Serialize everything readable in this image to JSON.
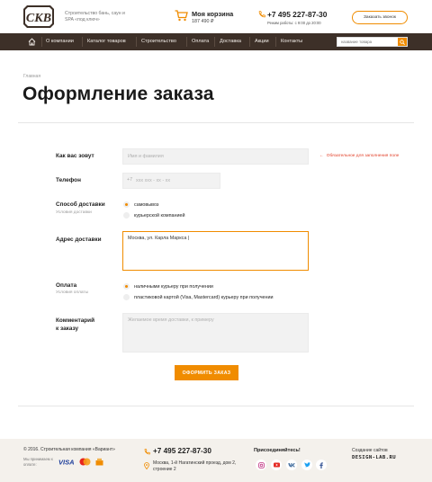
{
  "header": {
    "tagline": "Строительство бань, саун и SPA «под ключ»",
    "cart_title": "Моя корзина",
    "cart_sum": "187 490 ₽",
    "phone": "+7 495 227-87-30",
    "hours": "Режим работы: с 9:00 до 20:00",
    "callback_label": "Заказать звонок"
  },
  "nav": {
    "items": [
      "О компании",
      "Каталог товаров",
      "Строительство",
      "Оплата",
      "Доставка",
      "Акции",
      "Контакты"
    ],
    "search_placeholder": "название товара"
  },
  "breadcrumb": "Главная",
  "page_title": "Оформление заказа",
  "form": {
    "name_label": "Как вас зовут",
    "name_placeholder": "Имя и фамилия",
    "required_note": "Обязательное для заполнения поле",
    "phone_label": "Телефон",
    "phone_prefix": "+7",
    "phone_placeholder": "ххх ххх - хх - хх",
    "delivery_label": "Способ доставки",
    "delivery_sub": "Условия доставки",
    "delivery_options": [
      "самовывоз",
      "курьерской компанией"
    ],
    "delivery_selected": 0,
    "address_label": "Адрес доставки",
    "address_value": "Москва, ул. Карла Маркса |",
    "payment_label": "Оплата",
    "payment_sub": "Условия оплаты",
    "payment_options": [
      "наличными курьеру при получении",
      "пластиковой картой (Visa, Mastercard) курьеру при получении"
    ],
    "payment_selected": 0,
    "comment_label_1": "Комментарий",
    "comment_label_2": "к заказу",
    "comment_placeholder": "Желаемое время доставки, к примеру",
    "submit_label": "ОФОРМИТЬ ЗАКАЗ"
  },
  "footer": {
    "copyright": "© 2016. Строительная компания «Вариант»",
    "pay_label": "Мы принимаем к оплате:",
    "phone": "+7 495 227-87-30",
    "address": "Москва, 1-й Нагатинский проезд, дом 2, строение 2",
    "social_title": "Присоединяйтесь!",
    "made_label": "Создание сайтов",
    "made_brand": "DESIGN-LAB.RU",
    "visa_text": "VISA"
  },
  "colors": {
    "accent": "#f08c00",
    "nav_bg": "#3d3028",
    "footer_bg": "#f4f1ec",
    "required": "#e2412a"
  }
}
